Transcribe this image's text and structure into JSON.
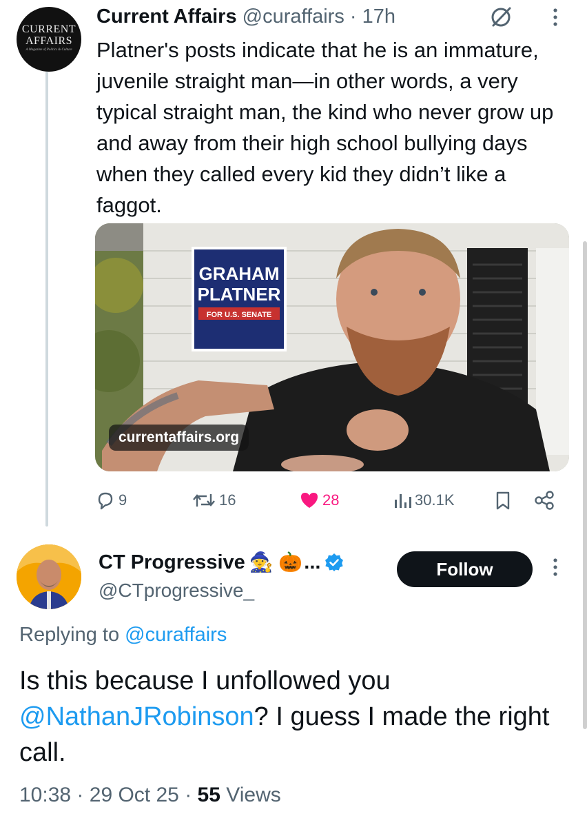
{
  "tweet": {
    "author": {
      "avatar_lines": [
        "CURRENT",
        "AFFAIRS",
        "A Magazine of Politics & Culture"
      ],
      "name": "Current Affairs",
      "handle": "@curaffairs",
      "separator": "·",
      "time": "17h"
    },
    "text": "Platner's posts indicate that he is an immature, juvenile straight man—in other words, a very typical straight man, the kind who never grow up and away from their high school bullying days when they called every kid they didn’t like a faggot.",
    "media": {
      "link_card_label": "currentaffairs.org",
      "sign_lines": [
        "GRAHAM",
        "PLATNER",
        "FOR U.S. SENATE"
      ]
    },
    "actions": {
      "replies": "9",
      "reposts": "16",
      "likes": "28",
      "views": "30.1K"
    },
    "icons": [
      "grok-icon",
      "more-icon",
      "reply-icon",
      "repost-icon",
      "heart-icon",
      "views-icon",
      "bookmark-icon",
      "share-icon"
    ],
    "like_color": "#f91880"
  },
  "reply": {
    "author": {
      "name": "CT Progressive",
      "emojis": "🧙 🎃",
      "ellipsis": "...",
      "verified": true,
      "handle": "@CTprogressive_"
    },
    "follow_label": "Follow",
    "replying_prefix": "Replying to",
    "replying_handle": "@curaffairs",
    "mention": "@NathanJRobinson",
    "text_before": "Is this because I unfollowed you",
    "text_after": "? I guess I made the right call.",
    "time": "10:38",
    "date": "29 Oct 25",
    "views_count": "55",
    "views_label": "Views",
    "separator": "·"
  },
  "colors": {
    "link": "#1d9bf0",
    "muted": "#536471",
    "text": "#0f1419",
    "verified": "#1d9bf0"
  }
}
